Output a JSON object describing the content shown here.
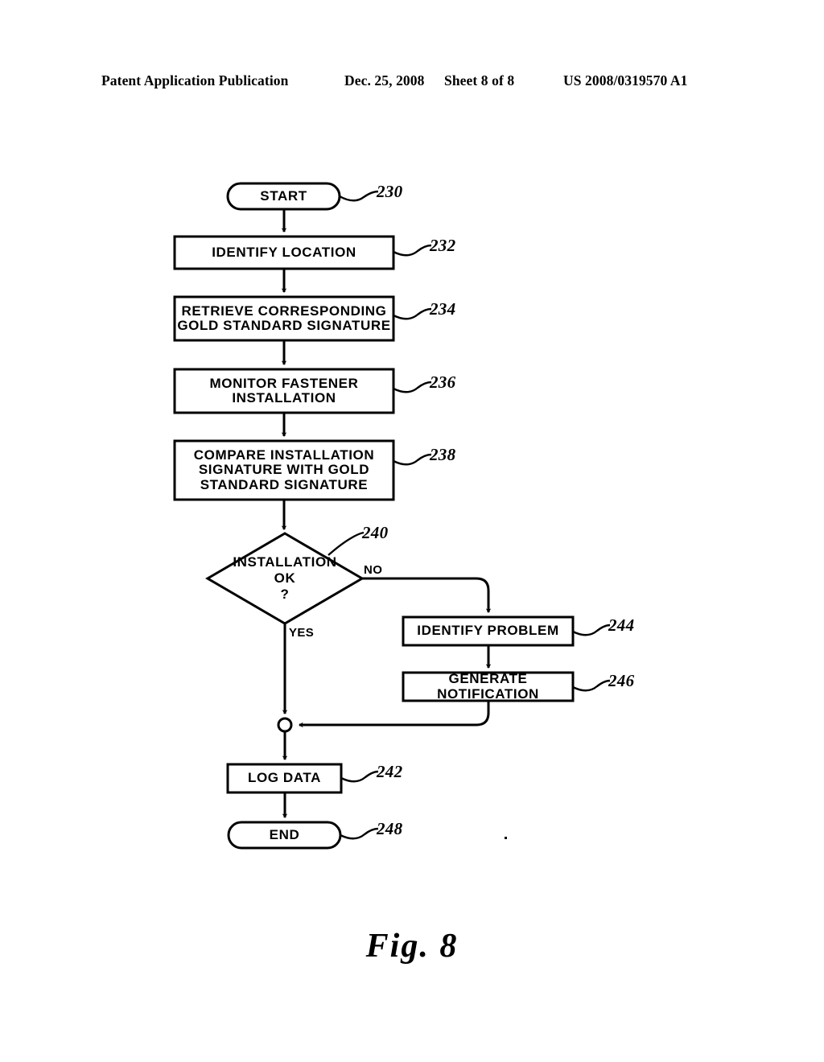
{
  "header": {
    "publication": "Patent Application Publication",
    "date": "Dec. 25, 2008",
    "sheet": "Sheet 8 of 8",
    "patent_number": "US 2008/0319570 A1"
  },
  "figure": {
    "caption": "Fig. 8",
    "type": "flowchart"
  },
  "nodes": {
    "start": {
      "label": "START",
      "ref": "230",
      "shape": "terminator"
    },
    "identify_location": {
      "label": "IDENTIFY  LOCATION",
      "ref": "232",
      "shape": "process"
    },
    "retrieve": {
      "label": "RETRIEVE  CORRESPONDING\nGOLD  STANDARD  SIGNATURE",
      "ref": "234",
      "shape": "process"
    },
    "monitor": {
      "label": "MONITOR  FASTENER\nINSTALLATION",
      "ref": "236",
      "shape": "process"
    },
    "compare": {
      "label": "COMPARE  INSTALLATION\nSIGNATURE  WITH  GOLD\nSTANDARD  SIGNATURE",
      "ref": "238",
      "shape": "process"
    },
    "decision": {
      "label": "INSTALLATION\nOK\n?",
      "ref": "240",
      "shape": "decision"
    },
    "identify_problem": {
      "label": "IDENTIFY  PROBLEM",
      "ref": "244",
      "shape": "process"
    },
    "generate_notification": {
      "label": "GENERATE  NOTIFICATION",
      "ref": "246",
      "shape": "process"
    },
    "log_data": {
      "label": "LOG  DATA",
      "ref": "242",
      "shape": "process"
    },
    "end": {
      "label": "END",
      "ref": "248",
      "shape": "terminator"
    },
    "junction": {
      "label": "",
      "ref": "",
      "shape": "connector-circle"
    }
  },
  "edges": {
    "yes_label": "YES",
    "no_label": "NO"
  },
  "style": {
    "line_color": "#000000",
    "fill_color": "#ffffff",
    "stroke_width": 3
  }
}
